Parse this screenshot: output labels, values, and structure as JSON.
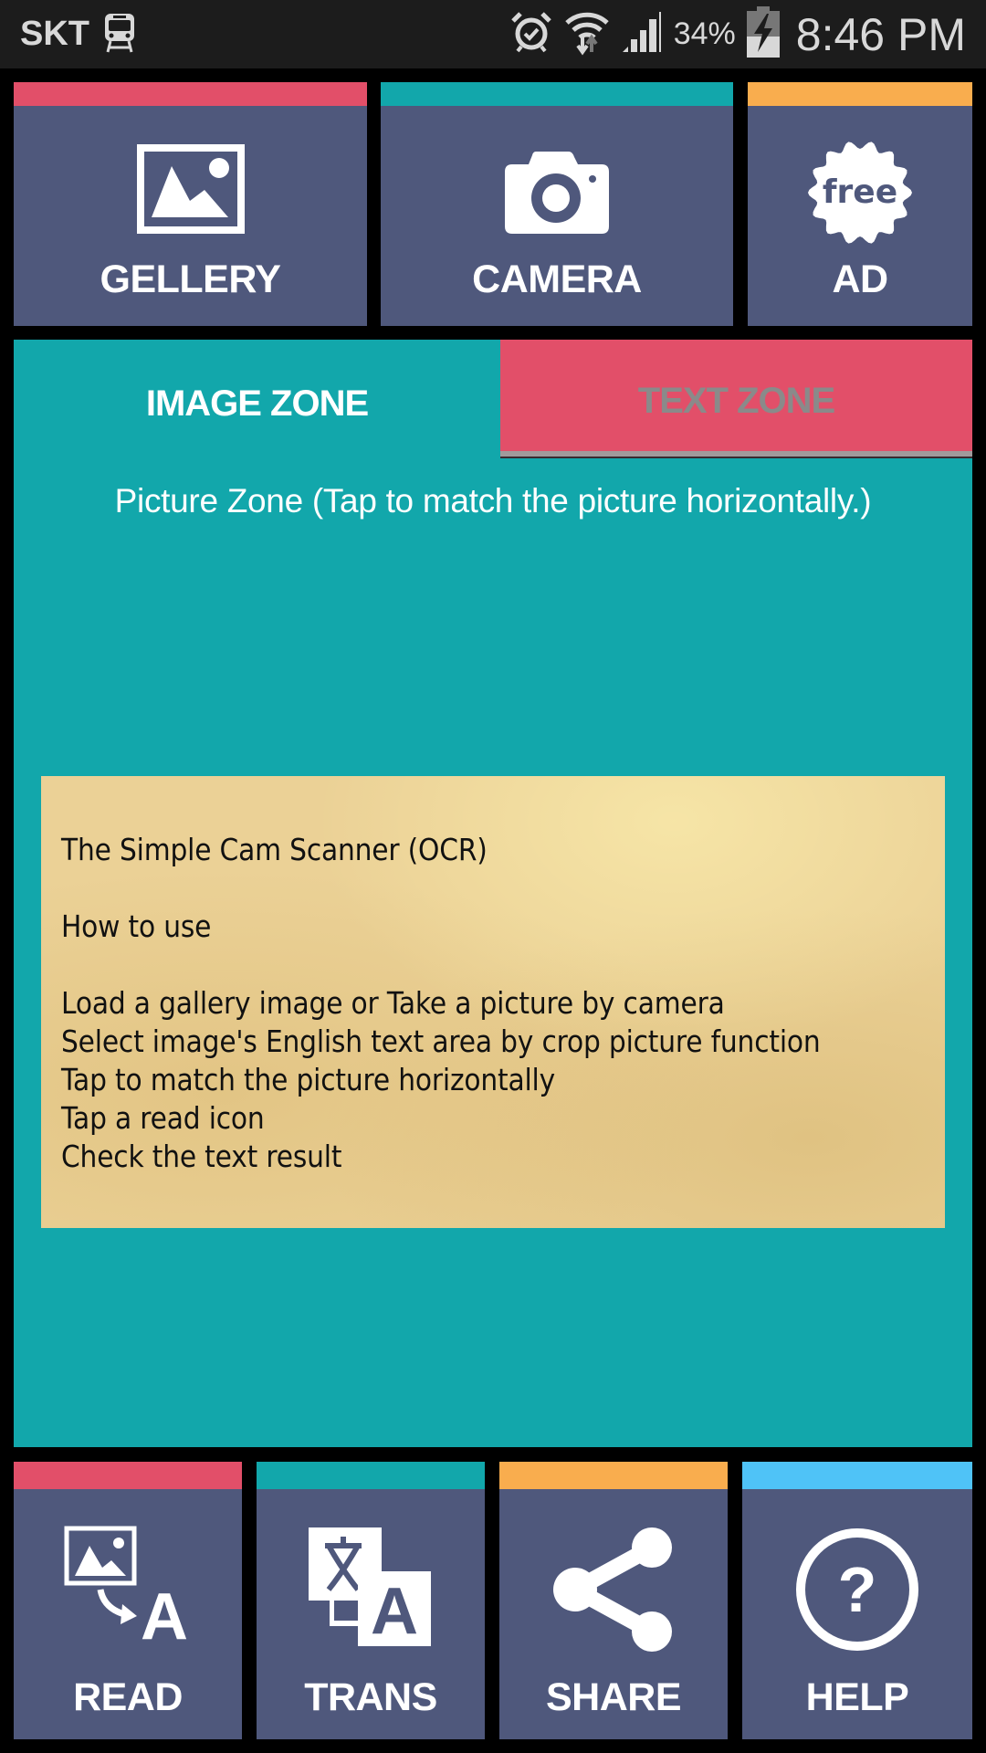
{
  "status_bar": {
    "carrier": "SKT",
    "battery_percent": "34%",
    "time": "8:46 PM",
    "icons": [
      "train-icon",
      "alarm-icon",
      "wifi-icon",
      "signal-icon",
      "battery-charging-icon"
    ]
  },
  "top_buttons": [
    {
      "label": "GELLERY",
      "icon": "gallery-icon",
      "accent": "#e24f69"
    },
    {
      "label": "CAMERA",
      "icon": "camera-icon",
      "accent": "#12a7ab"
    },
    {
      "label": "AD",
      "icon": "free-badge-icon",
      "icon_text": "free",
      "accent": "#f9ad4e"
    }
  ],
  "tabs": [
    {
      "label": "IMAGE ZONE",
      "selected": true
    },
    {
      "label": "TEXT ZONE",
      "selected": false
    }
  ],
  "picture_zone": {
    "hint": "Picture Zone (Tap to match the picture horizontally.)",
    "image_lines": [
      "The Simple Cam Scanner (OCR)",
      "",
      "How to use",
      "",
      "Load a gallery image or Take a picture by camera",
      "Select image's English text area by crop picture function",
      "Tap to match the picture horizontally",
      "Tap a read icon",
      "Check the text result"
    ]
  },
  "bottom_buttons": [
    {
      "label": "READ",
      "icon": "read-ocr-icon",
      "accent": "#e24f69"
    },
    {
      "label": "TRANS",
      "icon": "translate-icon",
      "accent": "#12a7ab"
    },
    {
      "label": "SHARE",
      "icon": "share-icon",
      "accent": "#f9ad4e"
    },
    {
      "label": "HELP",
      "icon": "help-icon",
      "accent": "#4fc3f7"
    }
  ]
}
